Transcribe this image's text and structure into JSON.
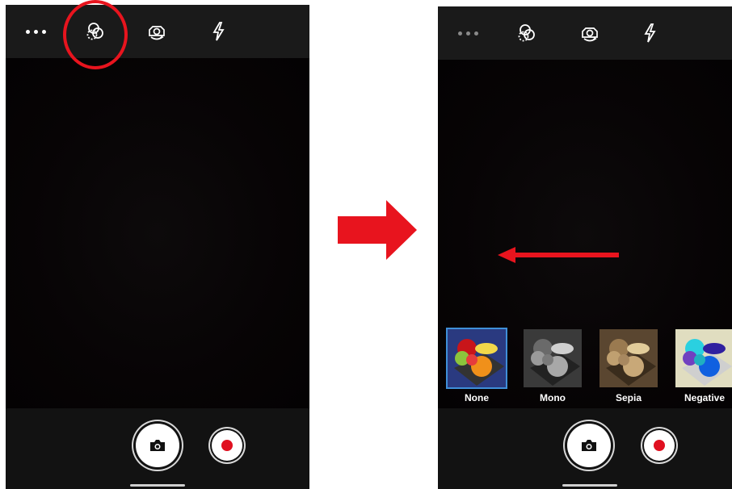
{
  "left_screen": {
    "toolbar": {
      "more_icon": "more-dots-icon",
      "filter_icon": "filter-circles-icon",
      "switch_camera_icon": "switch-camera-icon",
      "flash_icon": "flash-icon"
    },
    "highlight_color": "#e8141e"
  },
  "transition_arrow": {
    "color": "#e8141e"
  },
  "right_screen": {
    "toolbar": {
      "more_icon": "more-dots-icon",
      "filter_icon": "filter-circles-icon",
      "switch_camera_icon": "switch-camera-icon",
      "flash_icon": "flash-icon"
    },
    "filters": [
      {
        "label": "None",
        "selected": true
      },
      {
        "label": "Mono",
        "selected": false
      },
      {
        "label": "Sepia",
        "selected": false
      },
      {
        "label": "Negative",
        "selected": false
      }
    ],
    "swipe_direction": "left",
    "selection_color": "#3f8fd8"
  },
  "controls": {
    "shutter_icon": "camera-icon",
    "record_icon": "record-dot-icon",
    "record_color": "#e01020"
  }
}
